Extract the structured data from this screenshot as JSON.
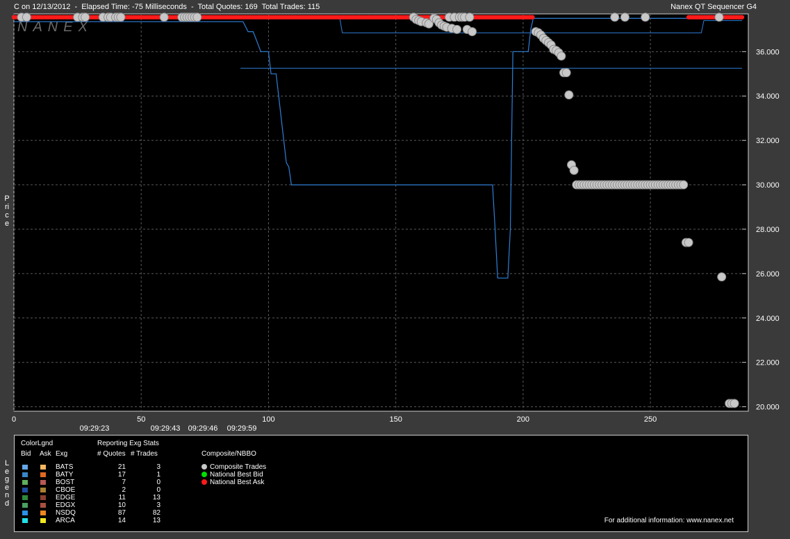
{
  "header": {
    "left": "C on 12/13/2012  -  Elapsed Time: -75 Milliseconds  -  Total Quotes: 169  Total Trades: 115",
    "right": "Nanex QT Sequencer G4"
  },
  "watermark": "NANEX",
  "ylabel": "Price",
  "legend_label": "Legend",
  "colors": {
    "background": "#000000",
    "frame": "#3a3a3a",
    "grid": "#5a5a5a",
    "nbbo_line": "#2f7fd8",
    "trade_fill": "#c8c8c8",
    "trade_stroke": "#8a8a8a",
    "best_bid": "#00dd00",
    "best_ask": "#ff1a1a"
  },
  "time_labels": [
    "09:29:23",
    "09:29:43",
    "09:29:46",
    "09:29:59"
  ],
  "chart_data": {
    "type": "scatter",
    "xlim": [
      0,
      286
    ],
    "ylim": [
      19.8,
      37.7
    ],
    "x_ticks": [
      0,
      50,
      100,
      150,
      200,
      250
    ],
    "y_ticks": [
      20,
      22,
      24,
      26,
      28,
      30,
      32,
      34,
      36
    ],
    "y_tick_labels": [
      "20.000",
      "22.000",
      "24.000",
      "26.000",
      "28.000",
      "30.000",
      "32.000",
      "34.000",
      "36.000"
    ],
    "grid": true,
    "best_ask": {
      "name": "National Best Ask",
      "y": 37.55,
      "x_ranges": [
        [
          0,
          204
        ],
        [
          265,
          286
        ]
      ]
    },
    "nbbo_bid_line": [
      [
        0,
        37.35
      ],
      [
        90,
        37.35
      ],
      [
        92,
        36.9
      ],
      [
        94,
        36.9
      ],
      [
        97,
        36.0
      ],
      [
        100,
        36.0
      ],
      [
        101,
        35.0
      ],
      [
        103,
        35.0
      ],
      [
        107,
        31.0
      ],
      [
        108,
        30.8
      ],
      [
        109,
        30.0
      ],
      [
        188,
        30.0
      ],
      [
        189,
        28.0
      ],
      [
        190,
        25.8
      ],
      [
        194,
        25.8
      ],
      [
        195,
        28.0
      ],
      [
        196,
        36.0
      ],
      [
        202,
        36.0
      ],
      [
        203,
        37.0
      ],
      [
        204,
        37.5
      ],
      [
        286,
        37.5
      ]
    ],
    "secondary_bid_line": [
      [
        128,
        37.5
      ],
      [
        129,
        36.85
      ],
      [
        270,
        36.85
      ],
      [
        271,
        37.4
      ],
      [
        286,
        37.4
      ]
    ],
    "horizontal_line": {
      "y": 35.25,
      "x": [
        89,
        286
      ]
    },
    "trades": {
      "name": "Composite Trades",
      "points": [
        [
          3,
          37.55
        ],
        [
          5,
          37.55
        ],
        [
          25,
          37.55
        ],
        [
          27,
          37.55
        ],
        [
          28,
          37.55
        ],
        [
          35,
          37.55
        ],
        [
          37,
          37.55
        ],
        [
          38,
          37.55
        ],
        [
          40,
          37.55
        ],
        [
          41,
          37.55
        ],
        [
          42,
          37.55
        ],
        [
          59,
          37.55
        ],
        [
          66,
          37.55
        ],
        [
          67,
          37.55
        ],
        [
          68,
          37.55
        ],
        [
          69,
          37.55
        ],
        [
          70,
          37.55
        ],
        [
          71,
          37.55
        ],
        [
          72,
          37.55
        ],
        [
          157,
          37.55
        ],
        [
          158,
          37.45
        ],
        [
          159,
          37.4
        ],
        [
          160,
          37.35
        ],
        [
          162,
          37.3
        ],
        [
          163,
          37.25
        ],
        [
          165,
          37.5
        ],
        [
          166,
          37.45
        ],
        [
          167,
          37.3
        ],
        [
          168,
          37.2
        ],
        [
          169,
          37.15
        ],
        [
          170,
          37.1
        ],
        [
          171,
          37.55
        ],
        [
          172,
          37.05
        ],
        [
          173,
          37.55
        ],
        [
          174,
          37.0
        ],
        [
          175,
          37.55
        ],
        [
          176,
          37.55
        ],
        [
          177,
          37.55
        ],
        [
          178,
          37.0
        ],
        [
          179,
          37.55
        ],
        [
          180,
          36.9
        ],
        [
          205,
          36.9
        ],
        [
          206,
          36.85
        ],
        [
          207,
          36.75
        ],
        [
          208,
          36.6
        ],
        [
          209,
          36.5
        ],
        [
          210,
          36.4
        ],
        [
          211,
          36.3
        ],
        [
          212,
          36.1
        ],
        [
          213,
          36.05
        ],
        [
          214,
          35.95
        ],
        [
          215,
          35.8
        ],
        [
          216,
          35.05
        ],
        [
          217,
          35.05
        ],
        [
          218,
          34.05
        ],
        [
          219,
          30.9
        ],
        [
          220,
          30.65
        ],
        [
          221,
          30.0
        ],
        [
          222,
          30.0
        ],
        [
          223,
          30.0
        ],
        [
          224,
          30.0
        ],
        [
          225,
          30.0
        ],
        [
          226,
          30.0
        ],
        [
          227,
          30.0
        ],
        [
          228,
          30.0
        ],
        [
          229,
          30.0
        ],
        [
          230,
          30.0
        ],
        [
          231,
          30.0
        ],
        [
          232,
          30.0
        ],
        [
          233,
          30.0
        ],
        [
          234,
          30.0
        ],
        [
          235,
          30.0
        ],
        [
          236,
          30.0
        ],
        [
          237,
          30.0
        ],
        [
          238,
          30.0
        ],
        [
          239,
          30.0
        ],
        [
          240,
          30.0
        ],
        [
          241,
          30.0
        ],
        [
          242,
          30.0
        ],
        [
          243,
          30.0
        ],
        [
          244,
          30.0
        ],
        [
          245,
          30.0
        ],
        [
          246,
          30.0
        ],
        [
          247,
          30.0
        ],
        [
          248,
          30.0
        ],
        [
          249,
          30.0
        ],
        [
          250,
          30.0
        ],
        [
          251,
          30.0
        ],
        [
          252,
          30.0
        ],
        [
          253,
          30.0
        ],
        [
          254,
          30.0
        ],
        [
          255,
          30.0
        ],
        [
          256,
          30.0
        ],
        [
          257,
          30.0
        ],
        [
          258,
          30.0
        ],
        [
          259,
          30.0
        ],
        [
          260,
          30.0
        ],
        [
          261,
          30.0
        ],
        [
          262,
          30.0
        ],
        [
          263,
          30.0
        ],
        [
          236,
          37.55
        ],
        [
          240,
          37.55
        ],
        [
          248,
          37.55
        ],
        [
          264,
          27.4
        ],
        [
          265,
          27.4
        ],
        [
          277,
          37.55
        ],
        [
          278,
          25.85
        ],
        [
          281,
          20.15
        ],
        [
          282,
          20.15
        ],
        [
          283,
          20.15
        ]
      ]
    }
  },
  "legend": {
    "colorlgnd": "ColorLgnd",
    "col_bid": "Bid",
    "col_ask": "Ask",
    "col_exg": "Exg",
    "stats_title": "Reporting Exg Stats",
    "col_quotes": "# Quotes",
    "col_trades": "# Trades",
    "composite_title": "Composite/NBBO",
    "rows": [
      {
        "exg": "BATS",
        "bid_color": "#64a8e8",
        "ask_color": "#f4b860",
        "quotes": "21",
        "trades": "3"
      },
      {
        "exg": "BATY",
        "bid_color": "#3a86c8",
        "ask_color": "#e06a20",
        "quotes": "17",
        "trades": "1"
      },
      {
        "exg": "BOST",
        "bid_color": "#5fae5f",
        "ask_color": "#b85858",
        "quotes": "7",
        "trades": "0"
      },
      {
        "exg": "CBOE",
        "bid_color": "#1d4ea0",
        "ask_color": "#a88030",
        "quotes": "2",
        "trades": "0"
      },
      {
        "exg": "EDGE",
        "bid_color": "#2f8a3a",
        "ask_color": "#8a4030",
        "quotes": "11",
        "trades": "13"
      },
      {
        "exg": "EDGX",
        "bid_color": "#4aa060",
        "ask_color": "#a85040",
        "quotes": "10",
        "trades": "3"
      },
      {
        "exg": "NSDQ",
        "bid_color": "#2a90e8",
        "ask_color": "#f08820",
        "quotes": "87",
        "trades": "82"
      },
      {
        "exg": "ARCA",
        "bid_color": "#20e0e8",
        "ask_color": "#f0e820",
        "quotes": "14",
        "trades": "13"
      }
    ],
    "composite": [
      {
        "label": "Composite Trades",
        "color": "#c8c8c8"
      },
      {
        "label": "National Best Bid",
        "color": "#00dd00"
      },
      {
        "label": "National Best Ask",
        "color": "#ff1a1a"
      }
    ],
    "info": "For additional information: www.nanex.net"
  }
}
